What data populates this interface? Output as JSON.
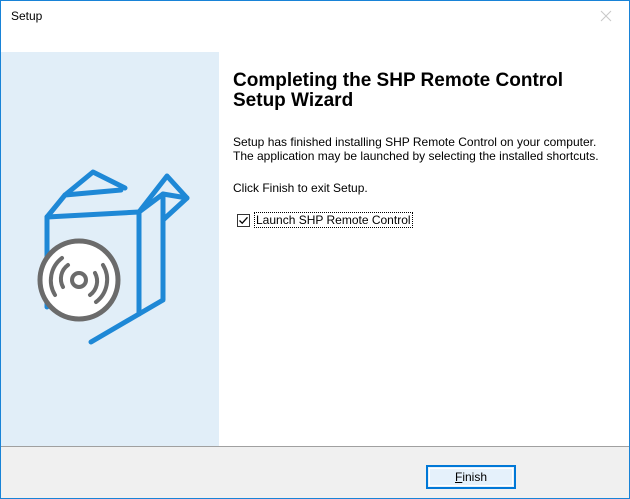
{
  "window": {
    "title": "Setup",
    "close_icon": "close-icon"
  },
  "sidebar": {
    "art_icon": "software-box-cd-icon",
    "colors": {
      "background": "#e1eef8",
      "box_stroke": "#1e88d6",
      "disc_stroke": "#6b6b6b"
    }
  },
  "content": {
    "heading": "Completing the SHP Remote Control Setup Wizard",
    "body": "Setup has finished installing SHP Remote Control on your computer. The application may be launched by selecting the installed shortcuts.",
    "finish_hint": "Click Finish to exit Setup.",
    "launch_checkbox": {
      "label": "Launch SHP Remote Control",
      "checked": true
    }
  },
  "buttons": {
    "finish_mnemonic": "F",
    "finish_rest": "inish"
  },
  "colors": {
    "accent": "#0078d7",
    "button_bg": "#e5f1fb",
    "footer_bg": "#f0f0f0"
  }
}
